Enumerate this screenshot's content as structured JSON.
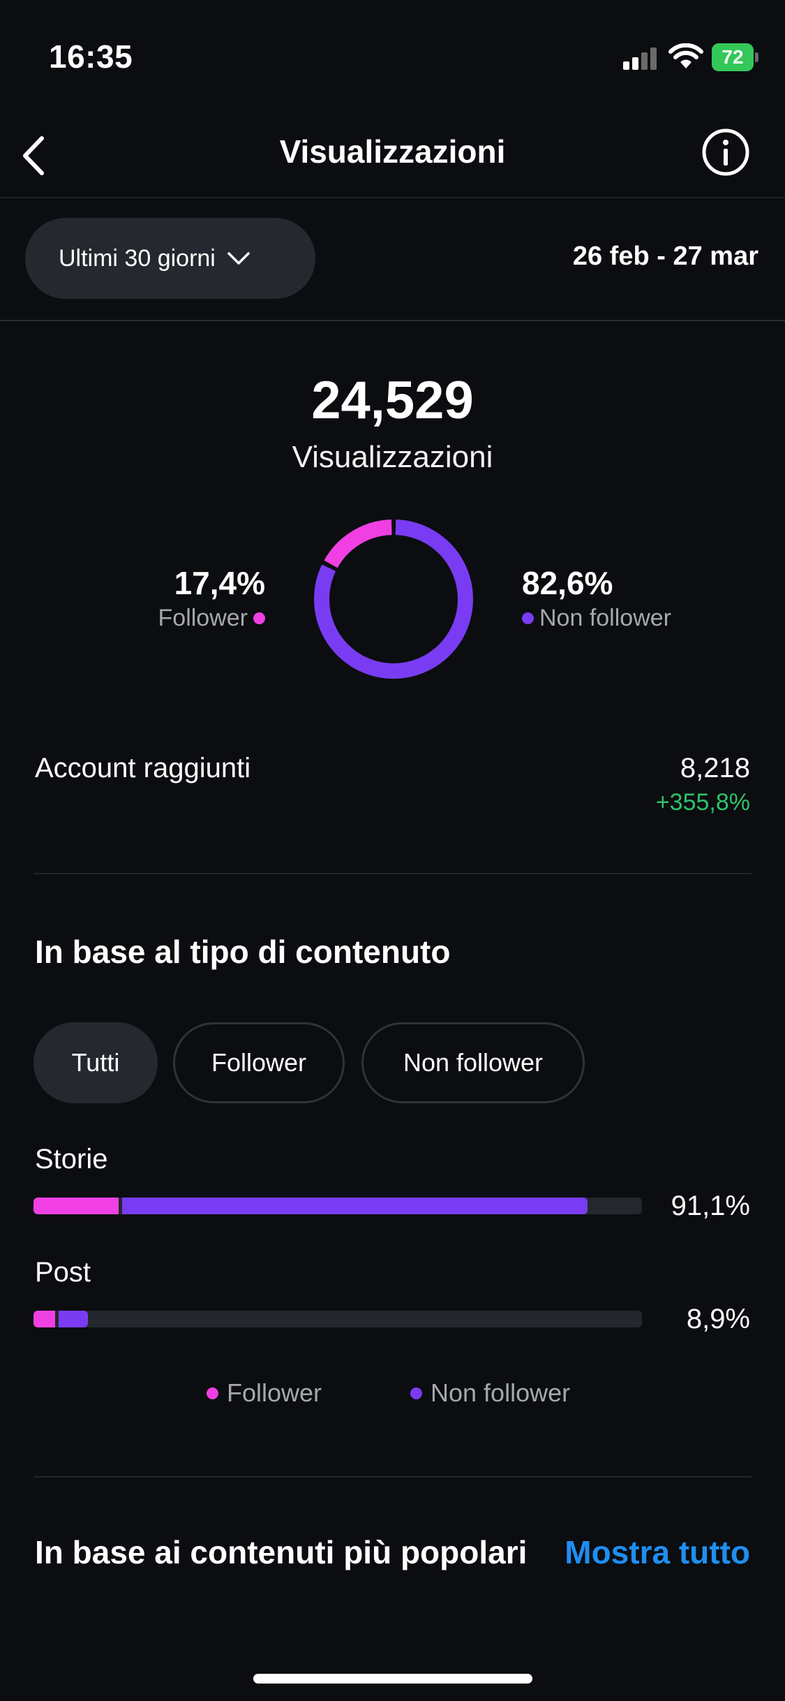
{
  "status_bar": {
    "time": "16:35",
    "battery": "72"
  },
  "header": {
    "title": "Visualizzazioni"
  },
  "date_row": {
    "period_label": "Ultimi 30 giorni",
    "range": "26 feb - 27 mar"
  },
  "summary": {
    "total_value": "24,529",
    "total_label": "Visualizzazioni",
    "follower_pct": "17,4%",
    "follower_label": "Follower",
    "follower_share": 0.174,
    "non_follower_pct": "82,6%",
    "non_follower_label": "Non follower",
    "non_follower_share": 0.826
  },
  "reach": {
    "label": "Account raggiunti",
    "value": "8,218",
    "change": "+355,8%"
  },
  "content_type": {
    "title": "In base al tipo di contenuto",
    "chips": [
      "Tutti",
      "Follower",
      "Non follower"
    ],
    "active_chip": "Tutti",
    "rows": [
      {
        "label": "Storie",
        "pct": "91,1%",
        "follower_fraction": 0.14,
        "non_follower_fraction": 0.77
      },
      {
        "label": "Post",
        "pct": "8,9%",
        "follower_fraction": 0.035,
        "non_follower_fraction": 0.054
      }
    ],
    "legend": {
      "follower": "Follower",
      "non_follower": "Non follower"
    }
  },
  "popular": {
    "title": "In base ai contenuti più popolari",
    "show_all": "Mostra tutto"
  },
  "colors": {
    "follower": "#f040e3",
    "non_follower": "#7a3cf2",
    "positive": "#2fc26a",
    "link": "#1f8ef1"
  }
}
